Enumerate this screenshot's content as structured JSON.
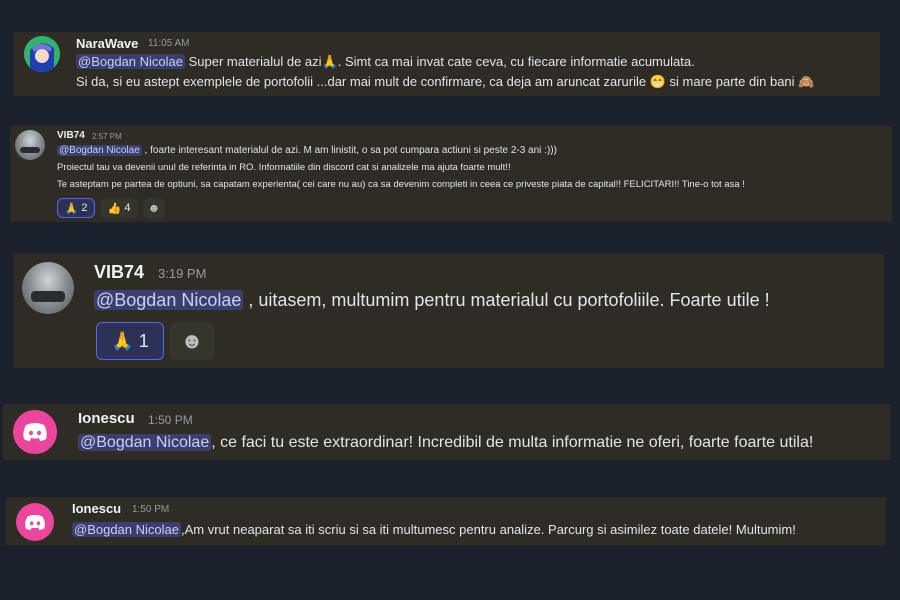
{
  "messages": [
    {
      "username": "NaraWave",
      "time": "11:05 AM",
      "mention": "@Bogdan Nicolae",
      "line1_a": " Super materialul de azi",
      "line1_emoji": "🙏",
      "line1_b": ". Simt ca mai invat cate ceva, cu fiecare informatie acumulata.",
      "line2_a": "Si da, si eu astept exemplele de portofolii ...dar mai mult de confirmare, ca deja am aruncat zarurile ",
      "line2_emoji1": "😁",
      "line2_b": " si mare parte din bani ",
      "line2_emoji2": "🙈"
    },
    {
      "username": "VIB74",
      "time": "2:57 PM",
      "mention": "@Bogdan Nicolae",
      "line1": " , foarte interesant materialul de azi. M am linistit, o sa pot cumpara actiuni si peste 2-3 ani :)))",
      "line2": "Proiectul tau va devenii unul de referinta in RO. Informatiile din discord cat si analizele ma ajuta foarte mult!!",
      "line3": "Te asteptam pe partea de optiuni, sa capatam experienta( cei care nu au)  ca sa devenim completi in ceea ce priveste piata de capital!! FELICITARI!! Tine-o tot asa !",
      "reactions": [
        {
          "emoji": "🙏",
          "count": "2"
        },
        {
          "emoji": "👍",
          "count": "4"
        }
      ],
      "add_reaction": "☻"
    },
    {
      "username": "VIB74",
      "time": "3:19 PM",
      "mention": "@Bogdan Nicolae",
      "line1": " , uitasem, multumim pentru materialul cu portofoliile. Foarte utile !",
      "reactions": [
        {
          "emoji": "🙏",
          "count": "1"
        }
      ],
      "add_reaction": "☻"
    },
    {
      "username": "Ionescu",
      "time": "1:50 PM",
      "mention": "@Bogdan Nicolae",
      "line1": ", ce faci tu este extraordinar! Incredibil de multa informatie ne oferi, foarte foarte utila!"
    },
    {
      "username": "Ionescu",
      "time": "1:50 PM",
      "mention": "@Bogdan Nicolae",
      "line1": ",Am vrut neaparat sa iti scriu si sa iti multumesc pentru analize. Parcurg si asimilez toate datele! Multumim!"
    }
  ],
  "colors": {
    "page_bg": "#1c212e",
    "message_bg": "#2e2c24",
    "mention_bg": "#3a3f6b",
    "mention_text": "#c9cdfb",
    "discord_pink": "#eb459e",
    "reaction_active_border": "#5865f2"
  },
  "icons": {
    "avatar_narawave": "anime-avatar-icon",
    "avatar_vib74": "car-avatar-icon",
    "avatar_ionescu": "discord-logo-icon",
    "add_reaction": "smiley-add-reaction-icon"
  }
}
